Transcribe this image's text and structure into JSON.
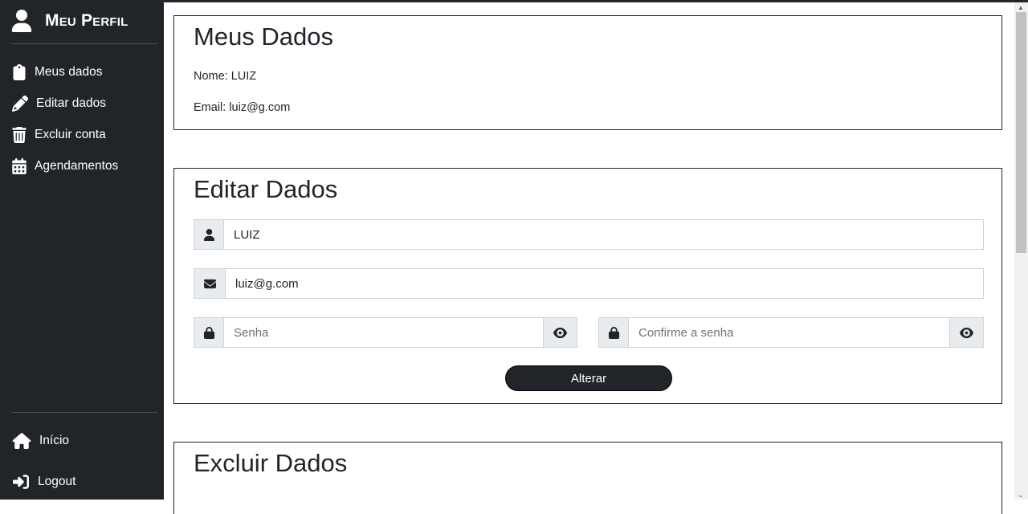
{
  "sidebar": {
    "brand": "Meu Perfil",
    "items": [
      {
        "label": "Meus dados",
        "icon": "clipboard-icon"
      },
      {
        "label": "Editar dados",
        "icon": "pencil-icon"
      },
      {
        "label": "Excluir conta",
        "icon": "trash-icon"
      },
      {
        "label": "Agendamentos",
        "icon": "calendar-icon"
      }
    ],
    "bottom": [
      {
        "label": "Início",
        "icon": "home-icon"
      },
      {
        "label": "Logout",
        "icon": "logout-icon"
      }
    ]
  },
  "meus_dados": {
    "title": "Meus Dados",
    "nome": "Nome: LUIZ",
    "email": "Email: luiz@g.com"
  },
  "editar": {
    "title": "Editar Dados",
    "nome_value": "LUIZ",
    "email_value": "luiz@g.com",
    "senha_placeholder": "Senha",
    "confirme_placeholder": "Confirme a senha",
    "button": "Alterar"
  },
  "excluir": {
    "title": "Excluir Dados"
  },
  "colors": {
    "sidebar_bg": "#212529",
    "addon_bg": "#e9ecef",
    "border": "#ced4da"
  }
}
